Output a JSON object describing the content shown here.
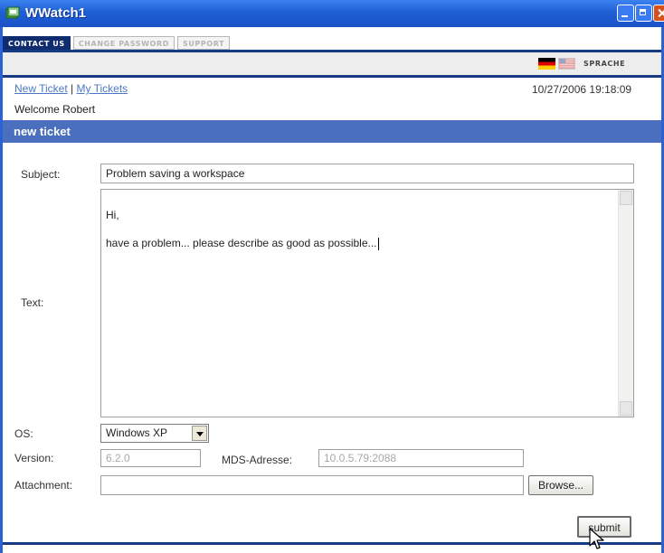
{
  "window": {
    "title": "WWatch1",
    "colors": {
      "titlebar": "#1f5fd4",
      "nav_dark": "#0e2c6e",
      "header_bar": "#4a6fbf",
      "link": "#4a78c6"
    }
  },
  "tabs": [
    {
      "label": "CONTACT US",
      "active": true
    },
    {
      "label": "CHANGE PASSWORD",
      "active": false
    },
    {
      "label": "SUPPORT",
      "active": false
    }
  ],
  "language": {
    "label": "SPRACHE",
    "flags": [
      "flag-germany-icon",
      "flag-uk-icon"
    ]
  },
  "nav": {
    "new_ticket": "New Ticket",
    "separator": "|",
    "my_tickets": "My Tickets"
  },
  "datetime": "10/27/2006 19:18:09",
  "welcome": {
    "text": "Welcome Robert"
  },
  "section_title": "new ticket",
  "form": {
    "subject_label": "Subject:",
    "subject_value": "Problem saving a workspace",
    "text_label": "Text:",
    "text_lines": [
      "Hi,",
      "have a problem... please describe as good as possible..."
    ],
    "os_label": "OS:",
    "os_value": "Windows XP",
    "version_label": "Version:",
    "version_value": "6.2.0",
    "mds_label": "MDS-Adresse:",
    "mds_value": "10.0.5.79:2088",
    "attachment_label": "Attachment:",
    "attachment_value": "",
    "browse_label": "Browse...",
    "submit_label": "submit"
  }
}
